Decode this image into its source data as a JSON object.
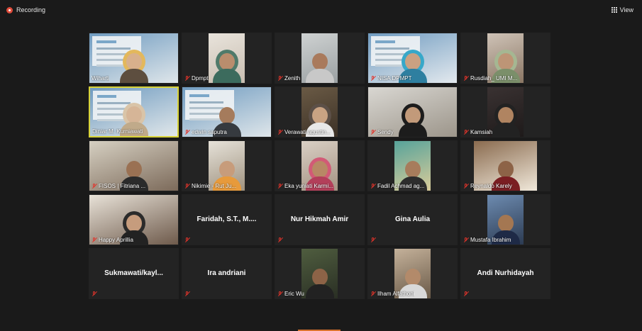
{
  "topbar": {
    "recording_label": "Recording",
    "view_label": "View",
    "view_icon": "grid-icon",
    "recording_icon": "record-icon"
  },
  "colors": {
    "background": "#1a1a1a",
    "tile": "#232323",
    "active_speaker_border": "#d8d338",
    "mute_icon": "#e2342b",
    "record_dot": "#e04b3a"
  },
  "participants": [
    {
      "name": "Wiharti",
      "video": true,
      "muted": false,
      "active": false
    },
    {
      "name": "Dpmpt",
      "video": true,
      "muted": true,
      "active": false
    },
    {
      "name": "Zenith",
      "video": true,
      "muted": true,
      "active": false
    },
    {
      "name": "NISA DPMPT",
      "video": true,
      "muted": true,
      "active": false
    },
    {
      "name": "Rusdiah_ UMI M...",
      "video": true,
      "muted": true,
      "active": false
    },
    {
      "name": "Diniar M. Kurniawati",
      "video": true,
      "muted": false,
      "active": true
    },
    {
      "name": "edwin saputra",
      "video": true,
      "muted": true,
      "active": false
    },
    {
      "name": "Verawati agustin...",
      "video": true,
      "muted": true,
      "active": false
    },
    {
      "name": "Sendy",
      "video": true,
      "muted": true,
      "active": false
    },
    {
      "name": "Kamsiah",
      "video": true,
      "muted": true,
      "active": false
    },
    {
      "name": "FISOS | Fitriana ...",
      "video": true,
      "muted": true,
      "active": false
    },
    {
      "name": "Nikimie - Rut Ju...",
      "video": true,
      "muted": true,
      "active": false
    },
    {
      "name": "Eka yuniati Karmi...",
      "video": true,
      "muted": true,
      "active": false
    },
    {
      "name": "Fadil Achmad ag...",
      "video": true,
      "muted": true,
      "active": false
    },
    {
      "name": "Reynaldo Karely",
      "video": true,
      "muted": true,
      "active": false
    },
    {
      "name": "Happy Aprillia",
      "video": true,
      "muted": true,
      "active": false
    },
    {
      "name": "Faridah, S.T., M....",
      "video": false,
      "muted": true,
      "active": false
    },
    {
      "name": "Nur Hikmah Amir",
      "video": false,
      "muted": true,
      "active": false
    },
    {
      "name": "Gina Aulia",
      "video": false,
      "muted": true,
      "active": false
    },
    {
      "name": "Mustafa Ibrahim",
      "video": true,
      "muted": true,
      "active": false
    },
    {
      "name": "Sukmawati/kayl...",
      "video": false,
      "muted": true,
      "active": false
    },
    {
      "name": "Ira andriani",
      "video": false,
      "muted": true,
      "active": false
    },
    {
      "name": "Eric Wu",
      "video": true,
      "muted": true,
      "active": false
    },
    {
      "name": "Ilham Alfathoni",
      "video": true,
      "muted": true,
      "active": false
    },
    {
      "name": "Andi Nurhidayah",
      "video": false,
      "muted": true,
      "active": false
    }
  ]
}
